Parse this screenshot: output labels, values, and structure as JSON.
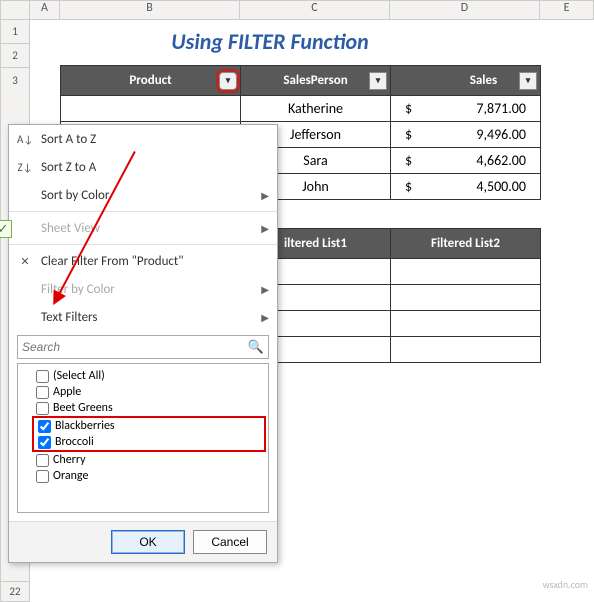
{
  "columns": {
    "A": "A",
    "B": "B",
    "C": "C",
    "D": "D",
    "E": "E"
  },
  "rows": {
    "r1": "1",
    "r2": "2",
    "r3": "3",
    "r22": "22"
  },
  "title": "Using FILTER Function",
  "table1": {
    "headers": {
      "product": "Product",
      "sales_person": "SalesPerson",
      "sales": "Sales"
    },
    "rows": [
      {
        "person": "Katherine",
        "cur": "$",
        "amount": "7,871.00"
      },
      {
        "person": "Jefferson",
        "cur": "$",
        "amount": "9,496.00"
      },
      {
        "person": "Sara",
        "cur": "$",
        "amount": "4,662.00"
      },
      {
        "person": "John",
        "cur": "$",
        "amount": "4,500.00"
      }
    ]
  },
  "table2": {
    "headers": {
      "h1": "iltered List1",
      "h2": "Filtered List2"
    }
  },
  "menu": {
    "sort_az": "Sort A to Z",
    "sort_za": "Sort Z to A",
    "sort_color": "Sort by Color",
    "sheet_view": "Sheet View",
    "clear": "Clear Filter From \"Product\"",
    "filter_color": "Filter by Color",
    "text_filters": "Text Filters",
    "search_placeholder": "Search",
    "items": {
      "select_all": "(Select All)",
      "apple": "Apple",
      "beet_greens": "Beet Greens",
      "blackberries": "Blackberries",
      "broccoli": "Broccoli",
      "cherry": "Cherry",
      "orange": "Orange"
    },
    "ok": "OK",
    "cancel": "Cancel"
  },
  "watermark": "wsxdn.com"
}
